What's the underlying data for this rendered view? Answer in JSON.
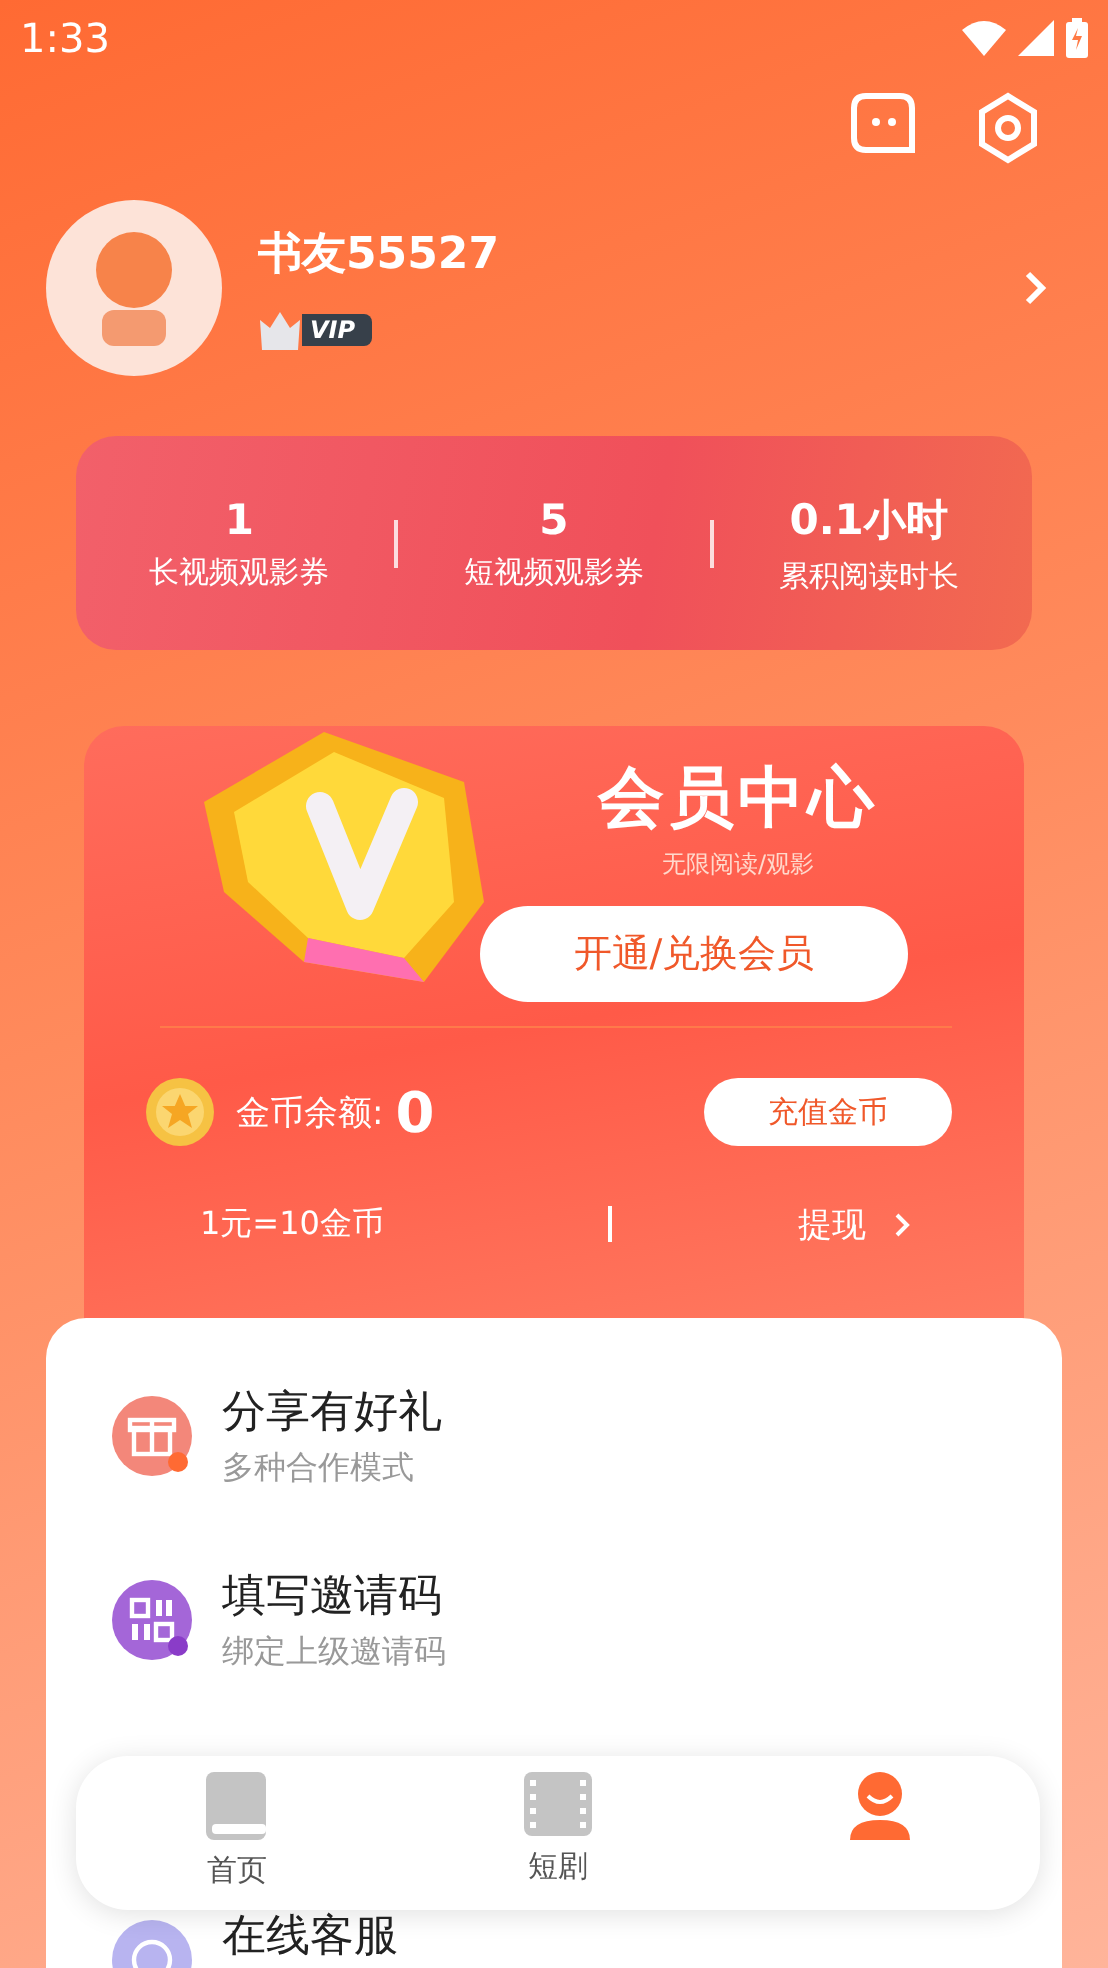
{
  "status_bar": {
    "time": "1:33"
  },
  "profile": {
    "name": "书友55527",
    "badge": "VIP"
  },
  "stats": [
    {
      "value": "1",
      "label": "长视频观影券"
    },
    {
      "value": "5",
      "label": "短视频观影券"
    },
    {
      "value": "0.1小时",
      "label": "累积阅读时长"
    }
  ],
  "vip_card": {
    "title": "会员中心",
    "subtitle": "无限阅读/观影",
    "button": "开通/兑换会员",
    "balance_label": "金币余额:",
    "balance": "0",
    "recharge_button": "充值金币",
    "rate": "1元=10金币",
    "withdraw": "提现"
  },
  "menu": [
    {
      "kind": "gift",
      "title": "分享有好礼",
      "subtitle": "多种合作模式"
    },
    {
      "kind": "code",
      "title": "填写邀请码",
      "subtitle": "绑定上级邀请码"
    },
    {
      "kind": "service",
      "title": "在线客服"
    }
  ],
  "nav": [
    {
      "kind": "book",
      "label": "首页",
      "selected": false
    },
    {
      "kind": "film",
      "label": "短剧",
      "selected": false
    },
    {
      "kind": "person",
      "selected": true
    }
  ]
}
